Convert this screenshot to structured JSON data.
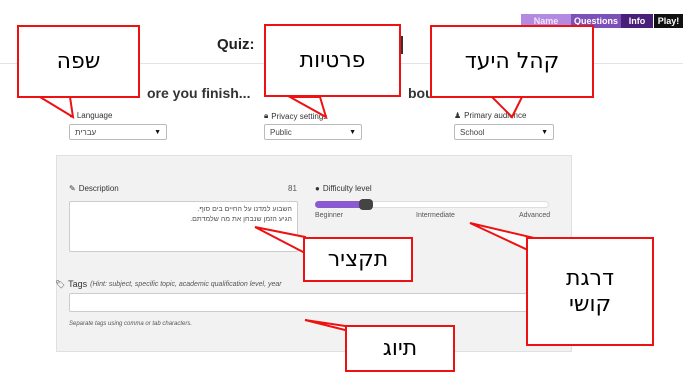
{
  "tabs": [
    {
      "label": "Name"
    },
    {
      "label": "Questions"
    },
    {
      "label": "Info"
    },
    {
      "label": "Play!"
    }
  ],
  "header": {
    "title_prefix": "Quiz:",
    "subtitle_start": "ore you finish...",
    "subtitle_end": "bout"
  },
  "fields": {
    "language": {
      "label": "Language",
      "value": "עברית"
    },
    "privacy": {
      "label": "Privacy settings",
      "value": "Public"
    },
    "audience": {
      "label": "Primary audience",
      "value": "School"
    },
    "description": {
      "label": "Description",
      "count": "81",
      "lines": [
        "השבוע למדנו על החיים בים סוף.",
        "הגיע הזמן שנבחן את מה שלמדתם."
      ]
    },
    "difficulty": {
      "label": "Difficulty level",
      "ticks": [
        "Beginner",
        "Intermediate",
        "Advanced"
      ],
      "value_fraction": 0.22
    },
    "tags": {
      "label": "Tags",
      "hint": "(Hint: subject, specific topic, academic qualification level, year",
      "help": "Separate tags using comma or tab characters."
    }
  },
  "callouts": {
    "language": "שפה",
    "privacy": "פרטיות",
    "audience": "קהל היעד",
    "description": "תקציר",
    "difficulty_line1": "דרגת",
    "difficulty_line2": "קושי",
    "tags": "תיוג"
  },
  "colors": {
    "tab_name": "#b48ae0",
    "tab_questions": "#7d4fb8",
    "tab_info": "#4a1f7a",
    "tab_play": "#111111",
    "slider_fill": "#8c5ad0",
    "callout_border": "#ee1111"
  },
  "icons": {
    "language": "comment-icon",
    "privacy": "lock-icon",
    "audience": "user-icon",
    "description": "pencil-icon",
    "difficulty": "circle-icon",
    "tags": "tag-icon"
  }
}
